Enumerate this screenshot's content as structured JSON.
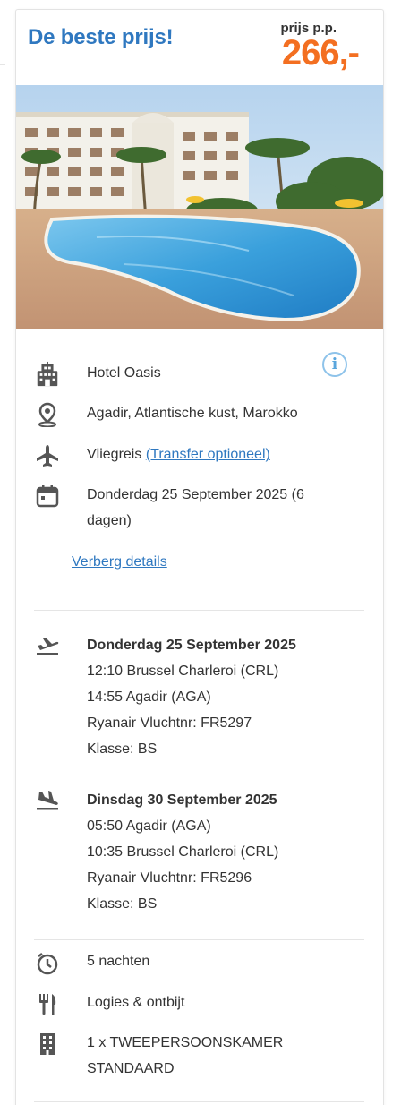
{
  "header": {
    "title": "De beste prijs!",
    "price_label": "prijs p.p.",
    "price_value": "266,-"
  },
  "image": {
    "alt": "Hotel Oasis pool"
  },
  "details": {
    "hotel_name": "Hotel Oasis",
    "location": "Agadir, Atlantische kust, Marokko",
    "travel_type": "Vliegreis",
    "transfer_link": "(Transfer optioneel)",
    "date_line": "Donderdag 25 September 2025 (6 dagen)",
    "hide_details_link": "Verberg details"
  },
  "flights": {
    "outbound": {
      "date": "Donderdag 25 September 2025",
      "departure": "12:10 Brussel Charleroi (CRL)",
      "arrival": "14:55 Agadir (AGA)",
      "carrier": "Ryanair Vluchtnr: FR5297",
      "class": "Klasse: BS"
    },
    "return": {
      "date": "Dinsdag 30 September 2025",
      "departure": "05:50 Agadir (AGA)",
      "arrival": "10:35 Brussel Charleroi (CRL)",
      "carrier": "Ryanair Vluchtnr: FR5296",
      "class": "Klasse: BS"
    }
  },
  "stay": {
    "nights": "5 nachten",
    "board": "Logies & ontbijt",
    "room": "1 x TWEEPERSOONSKAMER STANDAARD"
  },
  "icons": {
    "hotel": "building-icon",
    "location": "map-pin-icon",
    "travel": "airplane-icon",
    "date": "calendar-icon",
    "outbound": "plane-departure-icon",
    "return": "plane-arrival-icon",
    "nights": "clock-icon",
    "board": "fork-knife-icon",
    "room": "room-building-icon",
    "info": "info-icon"
  },
  "colors": {
    "title_blue": "#2f78c0",
    "price_orange": "#f36f21",
    "info_blue": "#8ec3ea",
    "icon_gray": "#555555"
  }
}
